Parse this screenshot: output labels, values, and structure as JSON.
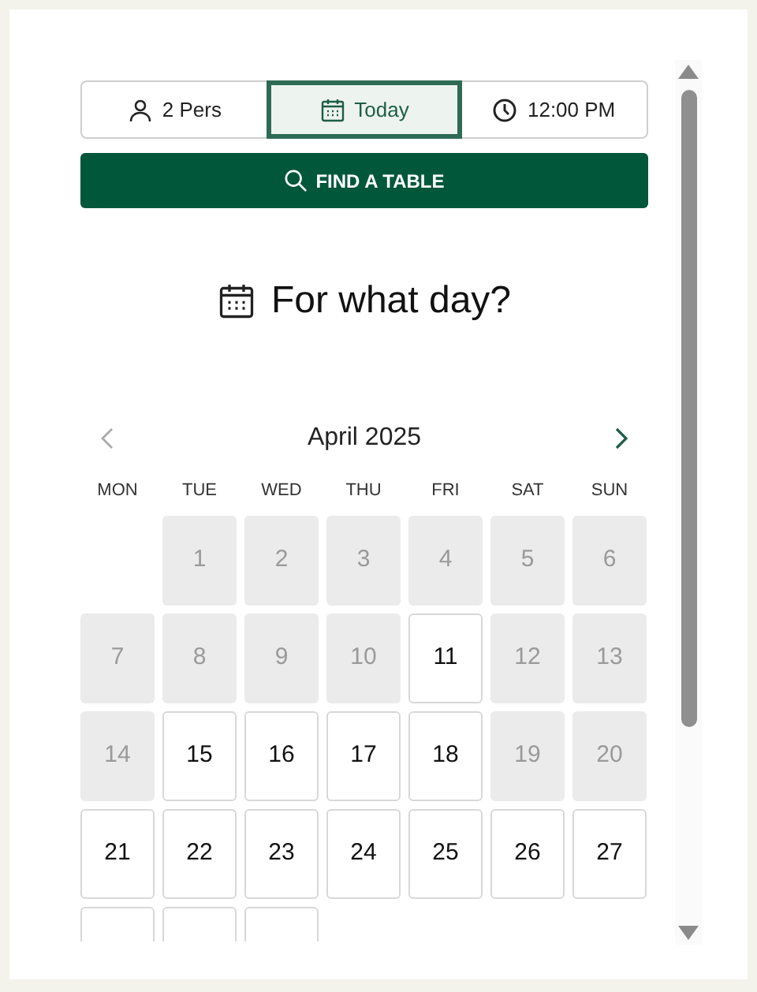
{
  "selector": [
    {
      "kind": "people",
      "label": "2 Pers",
      "selected": false
    },
    {
      "kind": "date",
      "label": "Today",
      "selected": true
    },
    {
      "kind": "time",
      "label": "12:00 PM",
      "selected": false
    }
  ],
  "find_button": {
    "label": "FIND A TABLE"
  },
  "heading": "For what day?",
  "calendar": {
    "month": "April 2025",
    "prev_disabled": true,
    "next_disabled": false,
    "weekdays": [
      "MON",
      "TUE",
      "WED",
      "THU",
      "FRI",
      "SAT",
      "SUN"
    ],
    "cells": [
      {
        "kind": "empty"
      },
      {
        "kind": "day",
        "label": "1",
        "disabled": true
      },
      {
        "kind": "day",
        "label": "2",
        "disabled": true
      },
      {
        "kind": "day",
        "label": "3",
        "disabled": true
      },
      {
        "kind": "day",
        "label": "4",
        "disabled": true
      },
      {
        "kind": "day",
        "label": "5",
        "disabled": true
      },
      {
        "kind": "day",
        "label": "6",
        "disabled": true
      },
      {
        "kind": "day",
        "label": "7",
        "disabled": true
      },
      {
        "kind": "day",
        "label": "8",
        "disabled": true
      },
      {
        "kind": "day",
        "label": "9",
        "disabled": true
      },
      {
        "kind": "day",
        "label": "10",
        "disabled": true
      },
      {
        "kind": "day",
        "label": "11",
        "disabled": false
      },
      {
        "kind": "day",
        "label": "12",
        "disabled": true
      },
      {
        "kind": "day",
        "label": "13",
        "disabled": true
      },
      {
        "kind": "day",
        "label": "14",
        "disabled": true
      },
      {
        "kind": "day",
        "label": "15",
        "disabled": false
      },
      {
        "kind": "day",
        "label": "16",
        "disabled": false
      },
      {
        "kind": "day",
        "label": "17",
        "disabled": false
      },
      {
        "kind": "day",
        "label": "18",
        "disabled": false
      },
      {
        "kind": "day",
        "label": "19",
        "disabled": true
      },
      {
        "kind": "day",
        "label": "20",
        "disabled": true
      },
      {
        "kind": "day",
        "label": "21",
        "disabled": false
      },
      {
        "kind": "day",
        "label": "22",
        "disabled": false
      },
      {
        "kind": "day",
        "label": "23",
        "disabled": false
      },
      {
        "kind": "day",
        "label": "24",
        "disabled": false
      },
      {
        "kind": "day",
        "label": "25",
        "disabled": false
      },
      {
        "kind": "day",
        "label": "26",
        "disabled": false
      },
      {
        "kind": "day",
        "label": "27",
        "disabled": false
      },
      {
        "kind": "cut"
      },
      {
        "kind": "cut"
      },
      {
        "kind": "cut"
      }
    ]
  }
}
